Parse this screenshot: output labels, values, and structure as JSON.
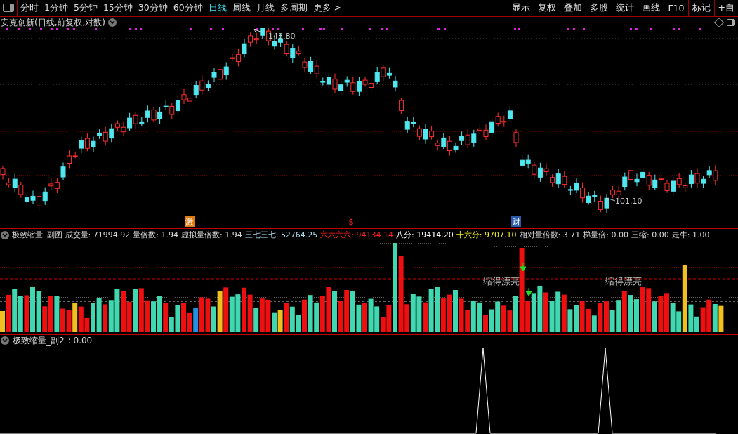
{
  "toolbar": {
    "periods": [
      {
        "label": "分时",
        "selected": false
      },
      {
        "label": "1分钟",
        "selected": false
      },
      {
        "label": "5分钟",
        "selected": false
      },
      {
        "label": "15分钟",
        "selected": false
      },
      {
        "label": "30分钟",
        "selected": false
      },
      {
        "label": "60分钟",
        "selected": false
      },
      {
        "label": "日线",
        "selected": true
      },
      {
        "label": "周线",
        "selected": false
      },
      {
        "label": "月线",
        "selected": false
      },
      {
        "label": "多周期",
        "selected": false
      }
    ],
    "more": "更多 >",
    "buttons": [
      "显示",
      "复权",
      "叠加",
      "多股",
      "统计",
      "画线",
      "F10",
      "标记",
      "+自"
    ]
  },
  "main_chart": {
    "title": "安克创新(日线,前复权,对数)",
    "high_label": "148.80",
    "low_label": "101.10",
    "markers": [
      {
        "text": "激",
        "color": "#e07a10",
        "kind": "badge"
      },
      {
        "text": "$",
        "color": "#e02020",
        "kind": "plain"
      },
      {
        "text": "财",
        "color": "#2a5aa8",
        "kind": "badge"
      }
    ]
  },
  "indicator_1": {
    "name": "极致缩量_副图",
    "values": [
      {
        "label": "成交量:",
        "value": "71994.92",
        "color": "#d8d8d8"
      },
      {
        "label": "量倍数:",
        "value": "1.94",
        "color": "#d8d8d8"
      },
      {
        "label": "虚拟量倍数:",
        "value": "1.94",
        "color": "#d8d8d8"
      },
      {
        "label": "三七三七:",
        "value": "52764.25",
        "color": "#a8dcf0"
      },
      {
        "label": "六六六六:",
        "value": "94134.14",
        "color": "#ff2020"
      },
      {
        "label": "八分:",
        "value": "19414.20",
        "color": "#ffffff"
      },
      {
        "label": "十六分:",
        "value": "9707.10",
        "color": "#f0f020"
      },
      {
        "label": "相对量倍数:",
        "value": "3.71",
        "color": "#d8d8d8"
      },
      {
        "label": "梯量倍:",
        "value": "0.00",
        "color": "#d8d8d8"
      },
      {
        "label": "三缩:",
        "value": "0.00",
        "color": "#d8d8d8"
      },
      {
        "label": "走牛:",
        "value": "1.00",
        "color": "#d8d8d8"
      }
    ],
    "annotations": [
      "缩得漂亮",
      "缩得漂亮"
    ]
  },
  "indicator_2": {
    "name": "极致缩量_副2",
    "value": ": 0.00"
  }
}
